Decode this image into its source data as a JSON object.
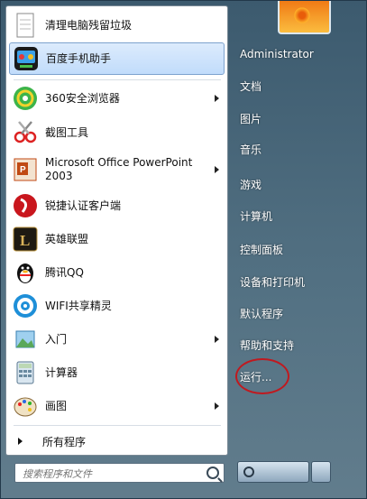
{
  "start_menu": {
    "pinned": [
      {
        "label": "清理电脑残留垃圾",
        "icon": "document-icon"
      },
      {
        "label": "百度手机助手",
        "icon": "baidu-phone-assistant-icon"
      }
    ],
    "recent": [
      {
        "label": "360安全浏览器",
        "icon": "360-browser-icon",
        "has_submenu": true
      },
      {
        "label": "截图工具",
        "icon": "scissors-icon",
        "has_submenu": false
      },
      {
        "label": "Microsoft Office PowerPoint 2003",
        "icon": "powerpoint-icon",
        "has_submenu": true
      },
      {
        "label": "锐捷认证客户端",
        "icon": "ruijie-icon",
        "has_submenu": false
      },
      {
        "label": "英雄联盟",
        "icon": "league-of-legends-icon",
        "has_submenu": false
      },
      {
        "label": "腾讯QQ",
        "icon": "qq-penguin-icon",
        "has_submenu": false
      },
      {
        "label": "WIFI共享精灵",
        "icon": "wifi-icon",
        "has_submenu": false
      },
      {
        "label": "入门",
        "icon": "getting-started-icon",
        "has_submenu": true
      },
      {
        "label": "计算器",
        "icon": "calculator-icon",
        "has_submenu": false
      },
      {
        "label": "画图",
        "icon": "paint-palette-icon",
        "has_submenu": true
      }
    ],
    "all_programs": "所有程序",
    "search_placeholder": "搜索程序和文件"
  },
  "right_panel": {
    "user": "Administrator",
    "items": [
      "文档",
      "图片",
      "音乐",
      "游戏",
      "计算机",
      "控制面板",
      "设备和打印机",
      "默认程序",
      "帮助和支持",
      "运行..."
    ]
  },
  "colors": {
    "highlight": "#c1dcfb",
    "annotation_circle": "#c0191f"
  }
}
